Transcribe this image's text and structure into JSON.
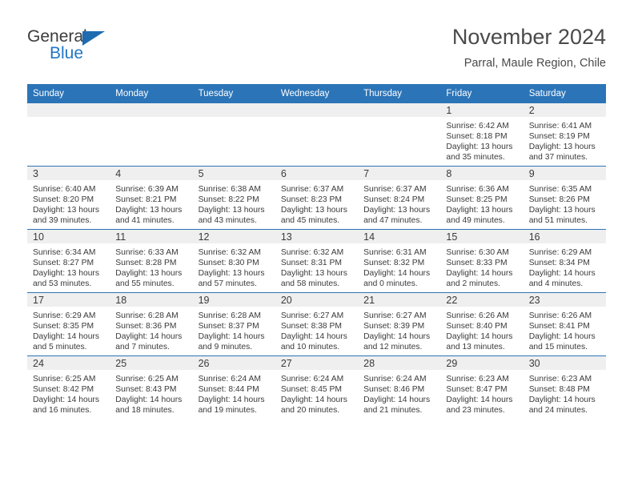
{
  "brand": {
    "name_top": "General",
    "name_bottom": "Blue",
    "accent_color": "#2276c4"
  },
  "header": {
    "title": "November 2024",
    "subtitle": "Parral, Maule Region, Chile"
  },
  "calendar": {
    "header_color": "#2b74b8",
    "daynum_band_color": "#efefef",
    "columns": [
      "Sunday",
      "Monday",
      "Tuesday",
      "Wednesday",
      "Thursday",
      "Friday",
      "Saturday"
    ],
    "weeks": [
      [
        {
          "day": "",
          "lines": []
        },
        {
          "day": "",
          "lines": []
        },
        {
          "day": "",
          "lines": []
        },
        {
          "day": "",
          "lines": []
        },
        {
          "day": "",
          "lines": []
        },
        {
          "day": "1",
          "lines": [
            "Sunrise: 6:42 AM",
            "Sunset: 8:18 PM",
            "Daylight: 13 hours",
            "and 35 minutes."
          ]
        },
        {
          "day": "2",
          "lines": [
            "Sunrise: 6:41 AM",
            "Sunset: 8:19 PM",
            "Daylight: 13 hours",
            "and 37 minutes."
          ]
        }
      ],
      [
        {
          "day": "3",
          "lines": [
            "Sunrise: 6:40 AM",
            "Sunset: 8:20 PM",
            "Daylight: 13 hours",
            "and 39 minutes."
          ]
        },
        {
          "day": "4",
          "lines": [
            "Sunrise: 6:39 AM",
            "Sunset: 8:21 PM",
            "Daylight: 13 hours",
            "and 41 minutes."
          ]
        },
        {
          "day": "5",
          "lines": [
            "Sunrise: 6:38 AM",
            "Sunset: 8:22 PM",
            "Daylight: 13 hours",
            "and 43 minutes."
          ]
        },
        {
          "day": "6",
          "lines": [
            "Sunrise: 6:37 AM",
            "Sunset: 8:23 PM",
            "Daylight: 13 hours",
            "and 45 minutes."
          ]
        },
        {
          "day": "7",
          "lines": [
            "Sunrise: 6:37 AM",
            "Sunset: 8:24 PM",
            "Daylight: 13 hours",
            "and 47 minutes."
          ]
        },
        {
          "day": "8",
          "lines": [
            "Sunrise: 6:36 AM",
            "Sunset: 8:25 PM",
            "Daylight: 13 hours",
            "and 49 minutes."
          ]
        },
        {
          "day": "9",
          "lines": [
            "Sunrise: 6:35 AM",
            "Sunset: 8:26 PM",
            "Daylight: 13 hours",
            "and 51 minutes."
          ]
        }
      ],
      [
        {
          "day": "10",
          "lines": [
            "Sunrise: 6:34 AM",
            "Sunset: 8:27 PM",
            "Daylight: 13 hours",
            "and 53 minutes."
          ]
        },
        {
          "day": "11",
          "lines": [
            "Sunrise: 6:33 AM",
            "Sunset: 8:28 PM",
            "Daylight: 13 hours",
            "and 55 minutes."
          ]
        },
        {
          "day": "12",
          "lines": [
            "Sunrise: 6:32 AM",
            "Sunset: 8:30 PM",
            "Daylight: 13 hours",
            "and 57 minutes."
          ]
        },
        {
          "day": "13",
          "lines": [
            "Sunrise: 6:32 AM",
            "Sunset: 8:31 PM",
            "Daylight: 13 hours",
            "and 58 minutes."
          ]
        },
        {
          "day": "14",
          "lines": [
            "Sunrise: 6:31 AM",
            "Sunset: 8:32 PM",
            "Daylight: 14 hours",
            "and 0 minutes."
          ]
        },
        {
          "day": "15",
          "lines": [
            "Sunrise: 6:30 AM",
            "Sunset: 8:33 PM",
            "Daylight: 14 hours",
            "and 2 minutes."
          ]
        },
        {
          "day": "16",
          "lines": [
            "Sunrise: 6:29 AM",
            "Sunset: 8:34 PM",
            "Daylight: 14 hours",
            "and 4 minutes."
          ]
        }
      ],
      [
        {
          "day": "17",
          "lines": [
            "Sunrise: 6:29 AM",
            "Sunset: 8:35 PM",
            "Daylight: 14 hours",
            "and 5 minutes."
          ]
        },
        {
          "day": "18",
          "lines": [
            "Sunrise: 6:28 AM",
            "Sunset: 8:36 PM",
            "Daylight: 14 hours",
            "and 7 minutes."
          ]
        },
        {
          "day": "19",
          "lines": [
            "Sunrise: 6:28 AM",
            "Sunset: 8:37 PM",
            "Daylight: 14 hours",
            "and 9 minutes."
          ]
        },
        {
          "day": "20",
          "lines": [
            "Sunrise: 6:27 AM",
            "Sunset: 8:38 PM",
            "Daylight: 14 hours",
            "and 10 minutes."
          ]
        },
        {
          "day": "21",
          "lines": [
            "Sunrise: 6:27 AM",
            "Sunset: 8:39 PM",
            "Daylight: 14 hours",
            "and 12 minutes."
          ]
        },
        {
          "day": "22",
          "lines": [
            "Sunrise: 6:26 AM",
            "Sunset: 8:40 PM",
            "Daylight: 14 hours",
            "and 13 minutes."
          ]
        },
        {
          "day": "23",
          "lines": [
            "Sunrise: 6:26 AM",
            "Sunset: 8:41 PM",
            "Daylight: 14 hours",
            "and 15 minutes."
          ]
        }
      ],
      [
        {
          "day": "24",
          "lines": [
            "Sunrise: 6:25 AM",
            "Sunset: 8:42 PM",
            "Daylight: 14 hours",
            "and 16 minutes."
          ]
        },
        {
          "day": "25",
          "lines": [
            "Sunrise: 6:25 AM",
            "Sunset: 8:43 PM",
            "Daylight: 14 hours",
            "and 18 minutes."
          ]
        },
        {
          "day": "26",
          "lines": [
            "Sunrise: 6:24 AM",
            "Sunset: 8:44 PM",
            "Daylight: 14 hours",
            "and 19 minutes."
          ]
        },
        {
          "day": "27",
          "lines": [
            "Sunrise: 6:24 AM",
            "Sunset: 8:45 PM",
            "Daylight: 14 hours",
            "and 20 minutes."
          ]
        },
        {
          "day": "28",
          "lines": [
            "Sunrise: 6:24 AM",
            "Sunset: 8:46 PM",
            "Daylight: 14 hours",
            "and 21 minutes."
          ]
        },
        {
          "day": "29",
          "lines": [
            "Sunrise: 6:23 AM",
            "Sunset: 8:47 PM",
            "Daylight: 14 hours",
            "and 23 minutes."
          ]
        },
        {
          "day": "30",
          "lines": [
            "Sunrise: 6:23 AM",
            "Sunset: 8:48 PM",
            "Daylight: 14 hours",
            "and 24 minutes."
          ]
        }
      ]
    ]
  }
}
